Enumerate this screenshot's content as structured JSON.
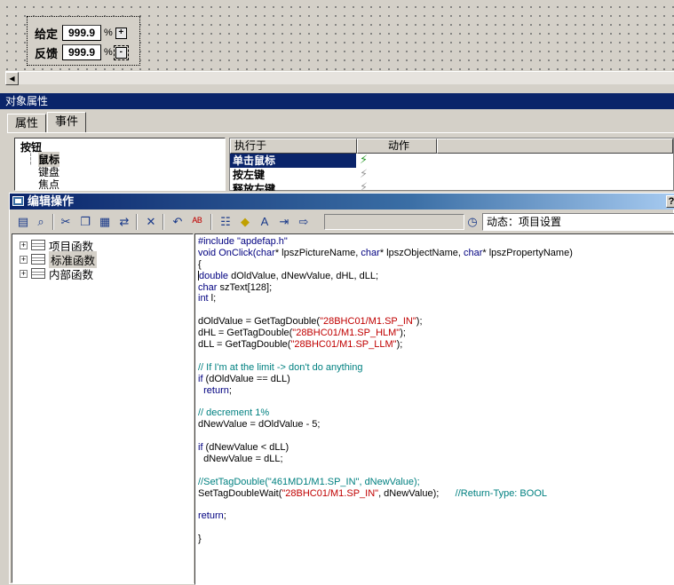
{
  "widget": {
    "setpoint_label": "给定",
    "setpoint_value": "999.9",
    "feedback_label": "反馈",
    "feedback_value": "999.9",
    "percent": "%",
    "plus_label": "+",
    "minus_label": "-"
  },
  "object_properties": {
    "title": "对象属性",
    "tabs": [
      "属性",
      "事件"
    ],
    "active_tab": 1,
    "event_tree": {
      "root": "按钮",
      "children": [
        "鼠标",
        "键盘",
        "焦点"
      ]
    },
    "event_table": {
      "headers": [
        "执行于",
        "动作"
      ],
      "rows": [
        "单击鼠标",
        "按左键",
        "释放左键"
      ]
    }
  },
  "edit_window": {
    "title": "编辑操作",
    "help": "?",
    "dynamic_field": "动态：项目设置",
    "function_tree": [
      "项目函数",
      "标准函数",
      "内部函数"
    ],
    "selected_function": 1,
    "code_lines": [
      [
        {
          "t": "#include \"apdefap.h\"",
          "c": "kw"
        }
      ],
      [
        {
          "t": "void OnClick(",
          "c": "kw"
        },
        {
          "t": "char",
          "c": "kw"
        },
        {
          "t": "* lpszPictureName, ",
          "c": ""
        },
        {
          "t": "char",
          "c": "kw"
        },
        {
          "t": "* lpszObjectName, ",
          "c": ""
        },
        {
          "t": "char",
          "c": "kw"
        },
        {
          "t": "* lpszPropertyName)",
          "c": ""
        }
      ],
      [
        {
          "t": "{",
          "c": ""
        }
      ],
      [
        {
          "t": "double",
          "c": "kw"
        },
        {
          "t": " dOldValue, dNewValue, dHL, dLL;",
          "c": ""
        }
      ],
      [
        {
          "t": "char",
          "c": "kw"
        },
        {
          "t": " szText[128];",
          "c": ""
        }
      ],
      [
        {
          "t": "int",
          "c": "kw"
        },
        {
          "t": " l;",
          "c": ""
        }
      ],
      [
        {
          "t": "",
          "c": ""
        }
      ],
      [
        {
          "t": "dOldValue = GetTagDouble(",
          "c": ""
        },
        {
          "t": "\"28BHC01/M1.SP_IN\"",
          "c": "str"
        },
        {
          "t": ");",
          "c": ""
        }
      ],
      [
        {
          "t": "dHL = GetTagDouble(",
          "c": ""
        },
        {
          "t": "\"28BHC01/M1.SP_HLM\"",
          "c": "str"
        },
        {
          "t": ");",
          "c": ""
        }
      ],
      [
        {
          "t": "dLL = GetTagDouble(",
          "c": ""
        },
        {
          "t": "\"28BHC01/M1.SP_LLM\"",
          "c": "str"
        },
        {
          "t": ");",
          "c": ""
        }
      ],
      [
        {
          "t": "",
          "c": ""
        }
      ],
      [
        {
          "t": "// If I'm at the limit -> don't do anything",
          "c": "cm"
        }
      ],
      [
        {
          "t": "if",
          "c": "kw"
        },
        {
          "t": " (dOldValue == dLL)",
          "c": ""
        }
      ],
      [
        {
          "t": "  ",
          "c": ""
        },
        {
          "t": "return",
          "c": "kw"
        },
        {
          "t": ";",
          "c": ""
        }
      ],
      [
        {
          "t": "",
          "c": ""
        }
      ],
      [
        {
          "t": "// decrement 1%",
          "c": "cm"
        }
      ],
      [
        {
          "t": "dNewValue = dOldValue - 5;",
          "c": ""
        }
      ],
      [
        {
          "t": "",
          "c": ""
        }
      ],
      [
        {
          "t": "if",
          "c": "kw"
        },
        {
          "t": " (dNewValue < dLL)",
          "c": ""
        }
      ],
      [
        {
          "t": "  dNewValue = dLL;",
          "c": ""
        }
      ],
      [
        {
          "t": "",
          "c": ""
        }
      ],
      [
        {
          "t": "//SetTagDouble(\"461MD1/M1.SP_IN\", dNewValue);",
          "c": "cm"
        }
      ],
      [
        {
          "t": "SetTagDoubleWait(",
          "c": ""
        },
        {
          "t": "\"28BHC01/M1.SP_IN\"",
          "c": "str"
        },
        {
          "t": ", dNewValue);      ",
          "c": ""
        },
        {
          "t": "//Return-Type: BOOL",
          "c": "cm"
        }
      ],
      [
        {
          "t": "",
          "c": ""
        }
      ],
      [
        {
          "t": "return",
          "c": "kw"
        },
        {
          "t": ";",
          "c": ""
        }
      ],
      [
        {
          "t": "",
          "c": ""
        }
      ],
      [
        {
          "t": "}",
          "c": ""
        }
      ]
    ]
  },
  "colors": {
    "title_bar": "#0a246a",
    "keyword": "#000080",
    "string": "#c00000",
    "comment": "#008080"
  }
}
